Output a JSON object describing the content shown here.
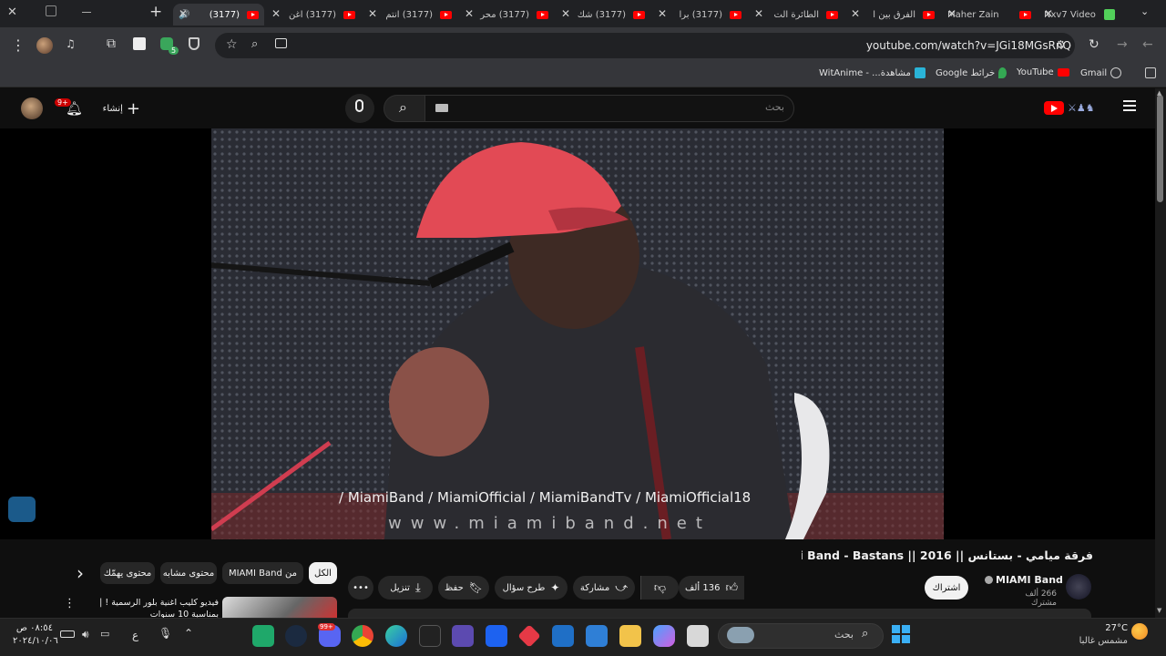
{
  "browser": {
    "tabs": [
      {
        "title": "Nxv7 Video"
      },
      {
        "title": "Maher Zain"
      },
      {
        "title": "الفرق بين ا"
      },
      {
        "title": "الطائرة الت"
      },
      {
        "title": "(3177) برا"
      },
      {
        "title": "(3177) شك"
      },
      {
        "title": "(3177) محر"
      },
      {
        "title": "(3177) انتم"
      },
      {
        "title": "(3177) اغن"
      },
      {
        "title": "(3177)"
      }
    ],
    "new_tab_label": "+",
    "url": "youtube.com/watch?v=JGi18MGsRnQ",
    "bookmarks": [
      {
        "label": "Gmail"
      },
      {
        "label": "YouTube"
      },
      {
        "label": "خرائط Google"
      },
      {
        "label": "مشاهدة... - WitAnime"
      }
    ],
    "extension_badge": "5"
  },
  "youtube": {
    "search_placeholder": "بحث",
    "create_label": "إنشاء",
    "notifications_badge": "9+",
    "video_watermark": "/ MiamiBand   / MiamiOfficial   / MiamiBandTv   / MiamiOfficial18",
    "video_site": "www.miamiband.net",
    "title": "فرقة ميامي - بستانس || 2016 || Miami Band - Bastans",
    "channel_name": "MIAMI Band",
    "subscribers": "266 ألف مشترك",
    "subscribe_label": "اشتراك",
    "like_count": "136 ألف",
    "share_label": "مشاركة",
    "ask_label": "طرح سؤال",
    "save_label": "حفظ",
    "download_label": "تنزيل",
    "more_label": "•••",
    "chips": [
      {
        "label": "الكل",
        "selected": true
      },
      {
        "label": "من MIAMI Band",
        "selected": false
      },
      {
        "label": "محتوى مشابه",
        "selected": false
      },
      {
        "label": "محتوى يهمّك",
        "selected": false
      }
    ],
    "chips_next": "›",
    "suggested": {
      "title": "فيديو كليب اغنية بلور الرسمية ! | بمناسبة 10 سنوات"
    }
  },
  "taskbar": {
    "search_label": "بحث",
    "weather_temp": "27°C",
    "weather_text": "مشمس غالبا",
    "time": "٠٨:٥٤ ص",
    "date": "٢٠٢٤/١٠/٠٦",
    "lang": "ع",
    "discord_badge": "99+"
  },
  "colors": {
    "accent": "#ff0000",
    "bg": "#0f0f0f"
  }
}
